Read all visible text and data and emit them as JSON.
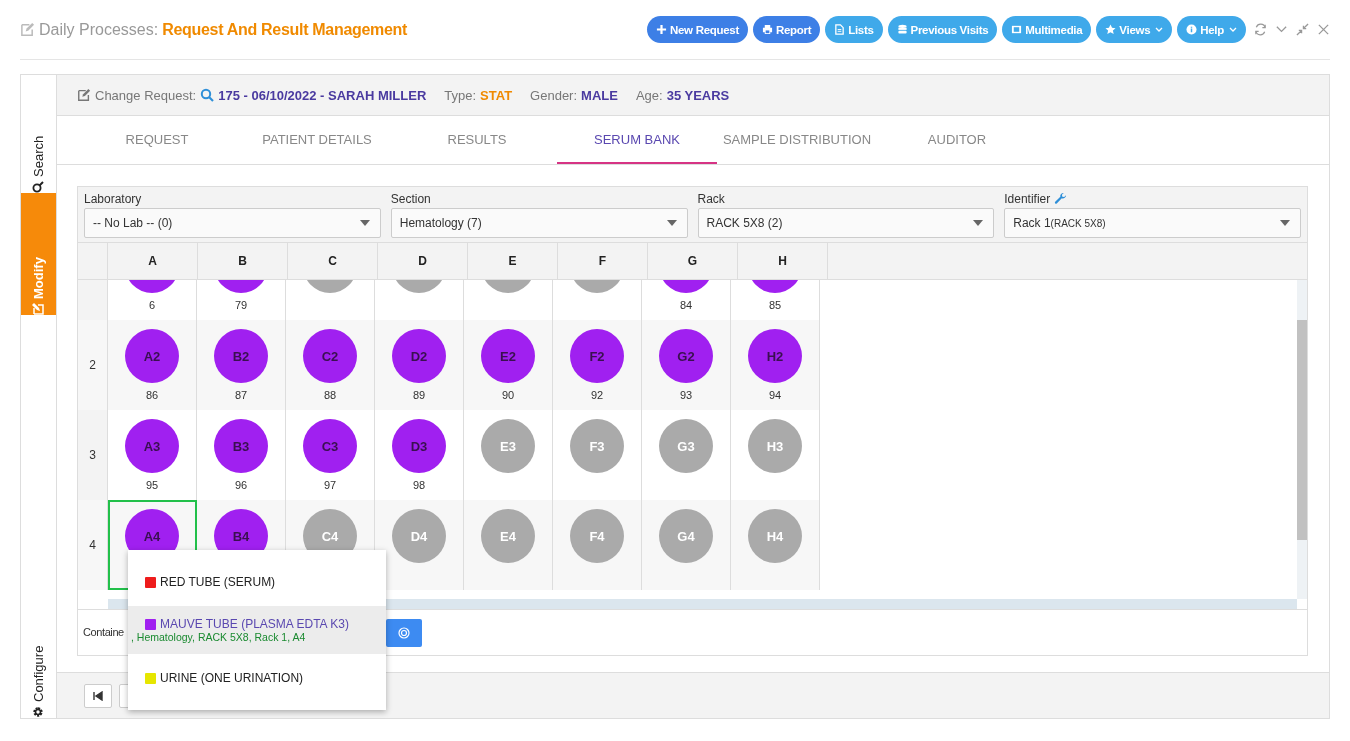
{
  "header": {
    "title_prefix": "Daily Processes:",
    "title": "Request And Result Management"
  },
  "toolbar": [
    {
      "label": "New Request",
      "kind": "primary",
      "dropdown": false
    },
    {
      "label": "Report",
      "kind": "primary",
      "dropdown": false
    },
    {
      "label": "Lists",
      "kind": "secondary",
      "dropdown": false
    },
    {
      "label": "Previous Visits",
      "kind": "secondary",
      "dropdown": false
    },
    {
      "label": "Multimedia",
      "kind": "secondary",
      "dropdown": false
    },
    {
      "label": "Views",
      "kind": "secondary",
      "dropdown": true
    },
    {
      "label": "Help",
      "kind": "secondary",
      "dropdown": true
    }
  ],
  "sidebar": [
    {
      "label": "Search",
      "selected": false
    },
    {
      "label": "Modify",
      "selected": true
    },
    {
      "label": "Configure",
      "selected": false
    }
  ],
  "request": {
    "label": "Change Request:",
    "value": "175 - 06/10/2022 - SARAH MILLER",
    "fields": [
      {
        "label": "Type:",
        "value": "STAT",
        "color": "#f08a00"
      },
      {
        "label": "Gender:",
        "value": "MALE",
        "color": "#4a3aa0"
      },
      {
        "label": "Age:",
        "value": "35 YEARS",
        "color": "#4a3aa0"
      }
    ]
  },
  "tabs": [
    {
      "label": "REQUEST",
      "selected": false
    },
    {
      "label": "PATIENT DETAILS",
      "selected": false
    },
    {
      "label": "RESULTS",
      "selected": false
    },
    {
      "label": "SERUM BANK",
      "selected": true
    },
    {
      "label": "SAMPLE DISTRIBUTION",
      "selected": false
    },
    {
      "label": "AUDITOR",
      "selected": false
    }
  ],
  "filters": [
    {
      "label": "Laboratory",
      "value": "-- No Lab -- (0)",
      "settings_icon": false
    },
    {
      "label": "Section",
      "value": "Hematology (7)",
      "settings_icon": false
    },
    {
      "label": "Rack",
      "value": "RACK 5X8 (2)",
      "settings_icon": false
    },
    {
      "label": "Identifier",
      "value": "Rack 1",
      "value_note": "(RACK 5X8)",
      "settings_icon": true
    }
  ],
  "grid": {
    "columns": [
      "A",
      "B",
      "C",
      "D",
      "E",
      "F",
      "G",
      "H"
    ],
    "rows": [
      {
        "cells": [
          {
            "filled": true,
            "selected": false,
            "number": "6"
          },
          {
            "filled": true,
            "selected": false,
            "number": "79"
          },
          {
            "filled": false,
            "selected": false
          },
          {
            "filled": false,
            "selected": false
          },
          {
            "filled": false,
            "selected": false
          },
          {
            "filled": false,
            "selected": false
          },
          {
            "filled": true,
            "selected": false,
            "number": "84"
          },
          {
            "filled": true,
            "selected": false,
            "number": "85"
          }
        ]
      },
      {
        "label": "2",
        "cells": [
          {
            "well": "A2",
            "filled": true,
            "selected": false,
            "number": "86"
          },
          {
            "well": "B2",
            "filled": true,
            "selected": false,
            "number": "87"
          },
          {
            "well": "C2",
            "filled": true,
            "selected": false,
            "number": "88"
          },
          {
            "well": "D2",
            "filled": true,
            "selected": false,
            "number": "89"
          },
          {
            "well": "E2",
            "filled": true,
            "selected": false,
            "number": "90"
          },
          {
            "well": "F2",
            "filled": true,
            "selected": false,
            "number": "92"
          },
          {
            "well": "G2",
            "filled": true,
            "selected": false,
            "number": "93"
          },
          {
            "well": "H2",
            "filled": true,
            "selected": false,
            "number": "94"
          }
        ]
      },
      {
        "label": "3",
        "cells": [
          {
            "well": "A3",
            "filled": true,
            "selected": false,
            "number": "95"
          },
          {
            "well": "B3",
            "filled": true,
            "selected": false,
            "number": "96"
          },
          {
            "well": "C3",
            "filled": true,
            "selected": false,
            "number": "97"
          },
          {
            "well": "D3",
            "filled": true,
            "selected": false,
            "number": "98"
          },
          {
            "well": "E3",
            "filled": false,
            "selected": false
          },
          {
            "well": "F3",
            "filled": false,
            "selected": false
          },
          {
            "well": "G3",
            "filled": false,
            "selected": false
          },
          {
            "well": "H3",
            "filled": false,
            "selected": false
          }
        ]
      },
      {
        "label": "4",
        "cells": [
          {
            "well": "A4",
            "filled": true,
            "selected": true
          },
          {
            "well": "B4",
            "filled": true,
            "selected": false
          },
          {
            "well": "C4",
            "filled": false,
            "selected": false
          },
          {
            "well": "D4",
            "filled": false,
            "selected": false
          },
          {
            "well": "E4",
            "filled": false,
            "selected": false
          },
          {
            "well": "F4",
            "filled": false,
            "selected": false
          },
          {
            "well": "G4",
            "filled": false,
            "selected": false
          },
          {
            "well": "H4",
            "filled": false,
            "selected": false
          }
        ]
      }
    ]
  },
  "container": {
    "label": "Containe"
  },
  "tube_menu": [
    {
      "label": "RED TUBE (SERUM)",
      "color": "#ee1c1c",
      "selected": false
    },
    {
      "label": "MAUVE TUBE (PLASMA EDTA K3)",
      "detail": ", Hematology, RACK 5X8, Rack 1, A4",
      "color": "#a020f0",
      "selected": true
    },
    {
      "label": "URINE (ONE URINATION)",
      "color": "#e6e600",
      "selected": false
    }
  ]
}
